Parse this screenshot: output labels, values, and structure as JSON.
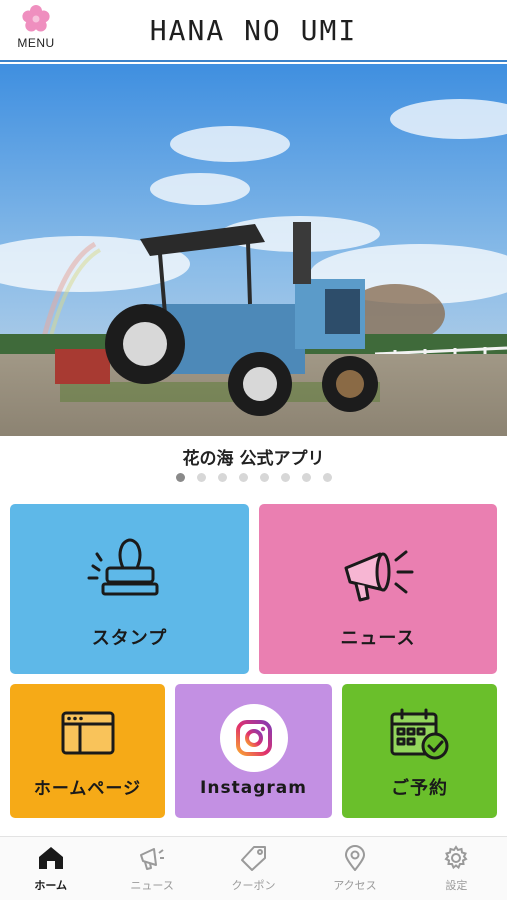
{
  "header": {
    "menu_label": "MENU",
    "app_title": "HANA NO UMI"
  },
  "hero": {
    "caption": "花の海 公式アプリ",
    "slide_count": 8,
    "active_slide": 1
  },
  "tiles": [
    {
      "label": "スタンプ",
      "color": "#5eb8e8",
      "icon": "stamp-icon"
    },
    {
      "label": "ニュース",
      "color": "#ea7fb1",
      "icon": "megaphone-icon"
    },
    {
      "label": "ホームページ",
      "color": "#f6aa17",
      "icon": "browser-window-icon"
    },
    {
      "label": "Instagram",
      "color": "#c390e3",
      "icon": "instagram-icon"
    },
    {
      "label": "ご予約",
      "color": "#6abf2b",
      "icon": "calendar-check-icon"
    }
  ],
  "bottom_nav": [
    {
      "label": "ホーム",
      "icon": "home-icon",
      "active": true
    },
    {
      "label": "ニュース",
      "icon": "megaphone-icon",
      "active": false
    },
    {
      "label": "クーポン",
      "icon": "tag-icon",
      "active": false
    },
    {
      "label": "アクセス",
      "icon": "map-pin-icon",
      "active": false
    },
    {
      "label": "設定",
      "icon": "gear-icon",
      "active": false
    }
  ]
}
